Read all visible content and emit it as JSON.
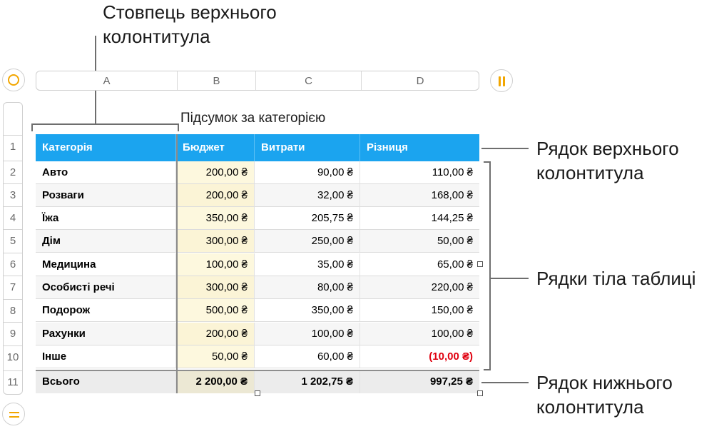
{
  "callouts": {
    "header_column": [
      "Стовпець верхнього",
      "колонтитула"
    ],
    "header_row": [
      "Рядок верхнього",
      "колонтитула"
    ],
    "body_rows": [
      "Рядки тіла таблиці"
    ],
    "footer_row": [
      "Рядок нижнього",
      "колонтитула"
    ]
  },
  "column_letters": [
    "A",
    "B",
    "C",
    "D"
  ],
  "row_numbers": [
    "1",
    "2",
    "3",
    "4",
    "5",
    "6",
    "7",
    "8",
    "9",
    "10",
    "11"
  ],
  "table": {
    "title": "Підсумок за категорією",
    "header": [
      "Категорія",
      "Бюджет",
      "Витрати",
      "Різниця"
    ],
    "rows": [
      [
        "Авто",
        "200,00 ₴",
        "90,00 ₴",
        "110,00 ₴"
      ],
      [
        "Розваги",
        "200,00 ₴",
        "32,00 ₴",
        "168,00 ₴"
      ],
      [
        "Їжа",
        "350,00 ₴",
        "205,75 ₴",
        "144,25 ₴"
      ],
      [
        "Дім",
        "300,00 ₴",
        "250,00 ₴",
        "50,00 ₴"
      ],
      [
        "Медицина",
        "100,00 ₴",
        "35,00 ₴",
        "65,00 ₴"
      ],
      [
        "Особисті речі",
        "300,00 ₴",
        "80,00 ₴",
        "220,00 ₴"
      ],
      [
        "Подорож",
        "500,00 ₴",
        "350,00 ₴",
        "150,00 ₴"
      ],
      [
        "Рахунки",
        "200,00 ₴",
        "100,00 ₴",
        "100,00 ₴"
      ],
      [
        "Інше",
        "50,00 ₴",
        "60,00 ₴",
        "(10,00 ₴)"
      ]
    ],
    "footer": [
      "Всього",
      "2 200,00 ₴",
      "1 202,75 ₴",
      "997,25 ₴"
    ]
  },
  "icons": {
    "table_select": "circle-select-icon",
    "columns_handle": "pause-bars-icon",
    "rows_handle": "equals-bars-icon"
  },
  "colors": {
    "header_bg": "#1ba4ef",
    "accent": "#f2a600",
    "negative": "#e0000f"
  }
}
